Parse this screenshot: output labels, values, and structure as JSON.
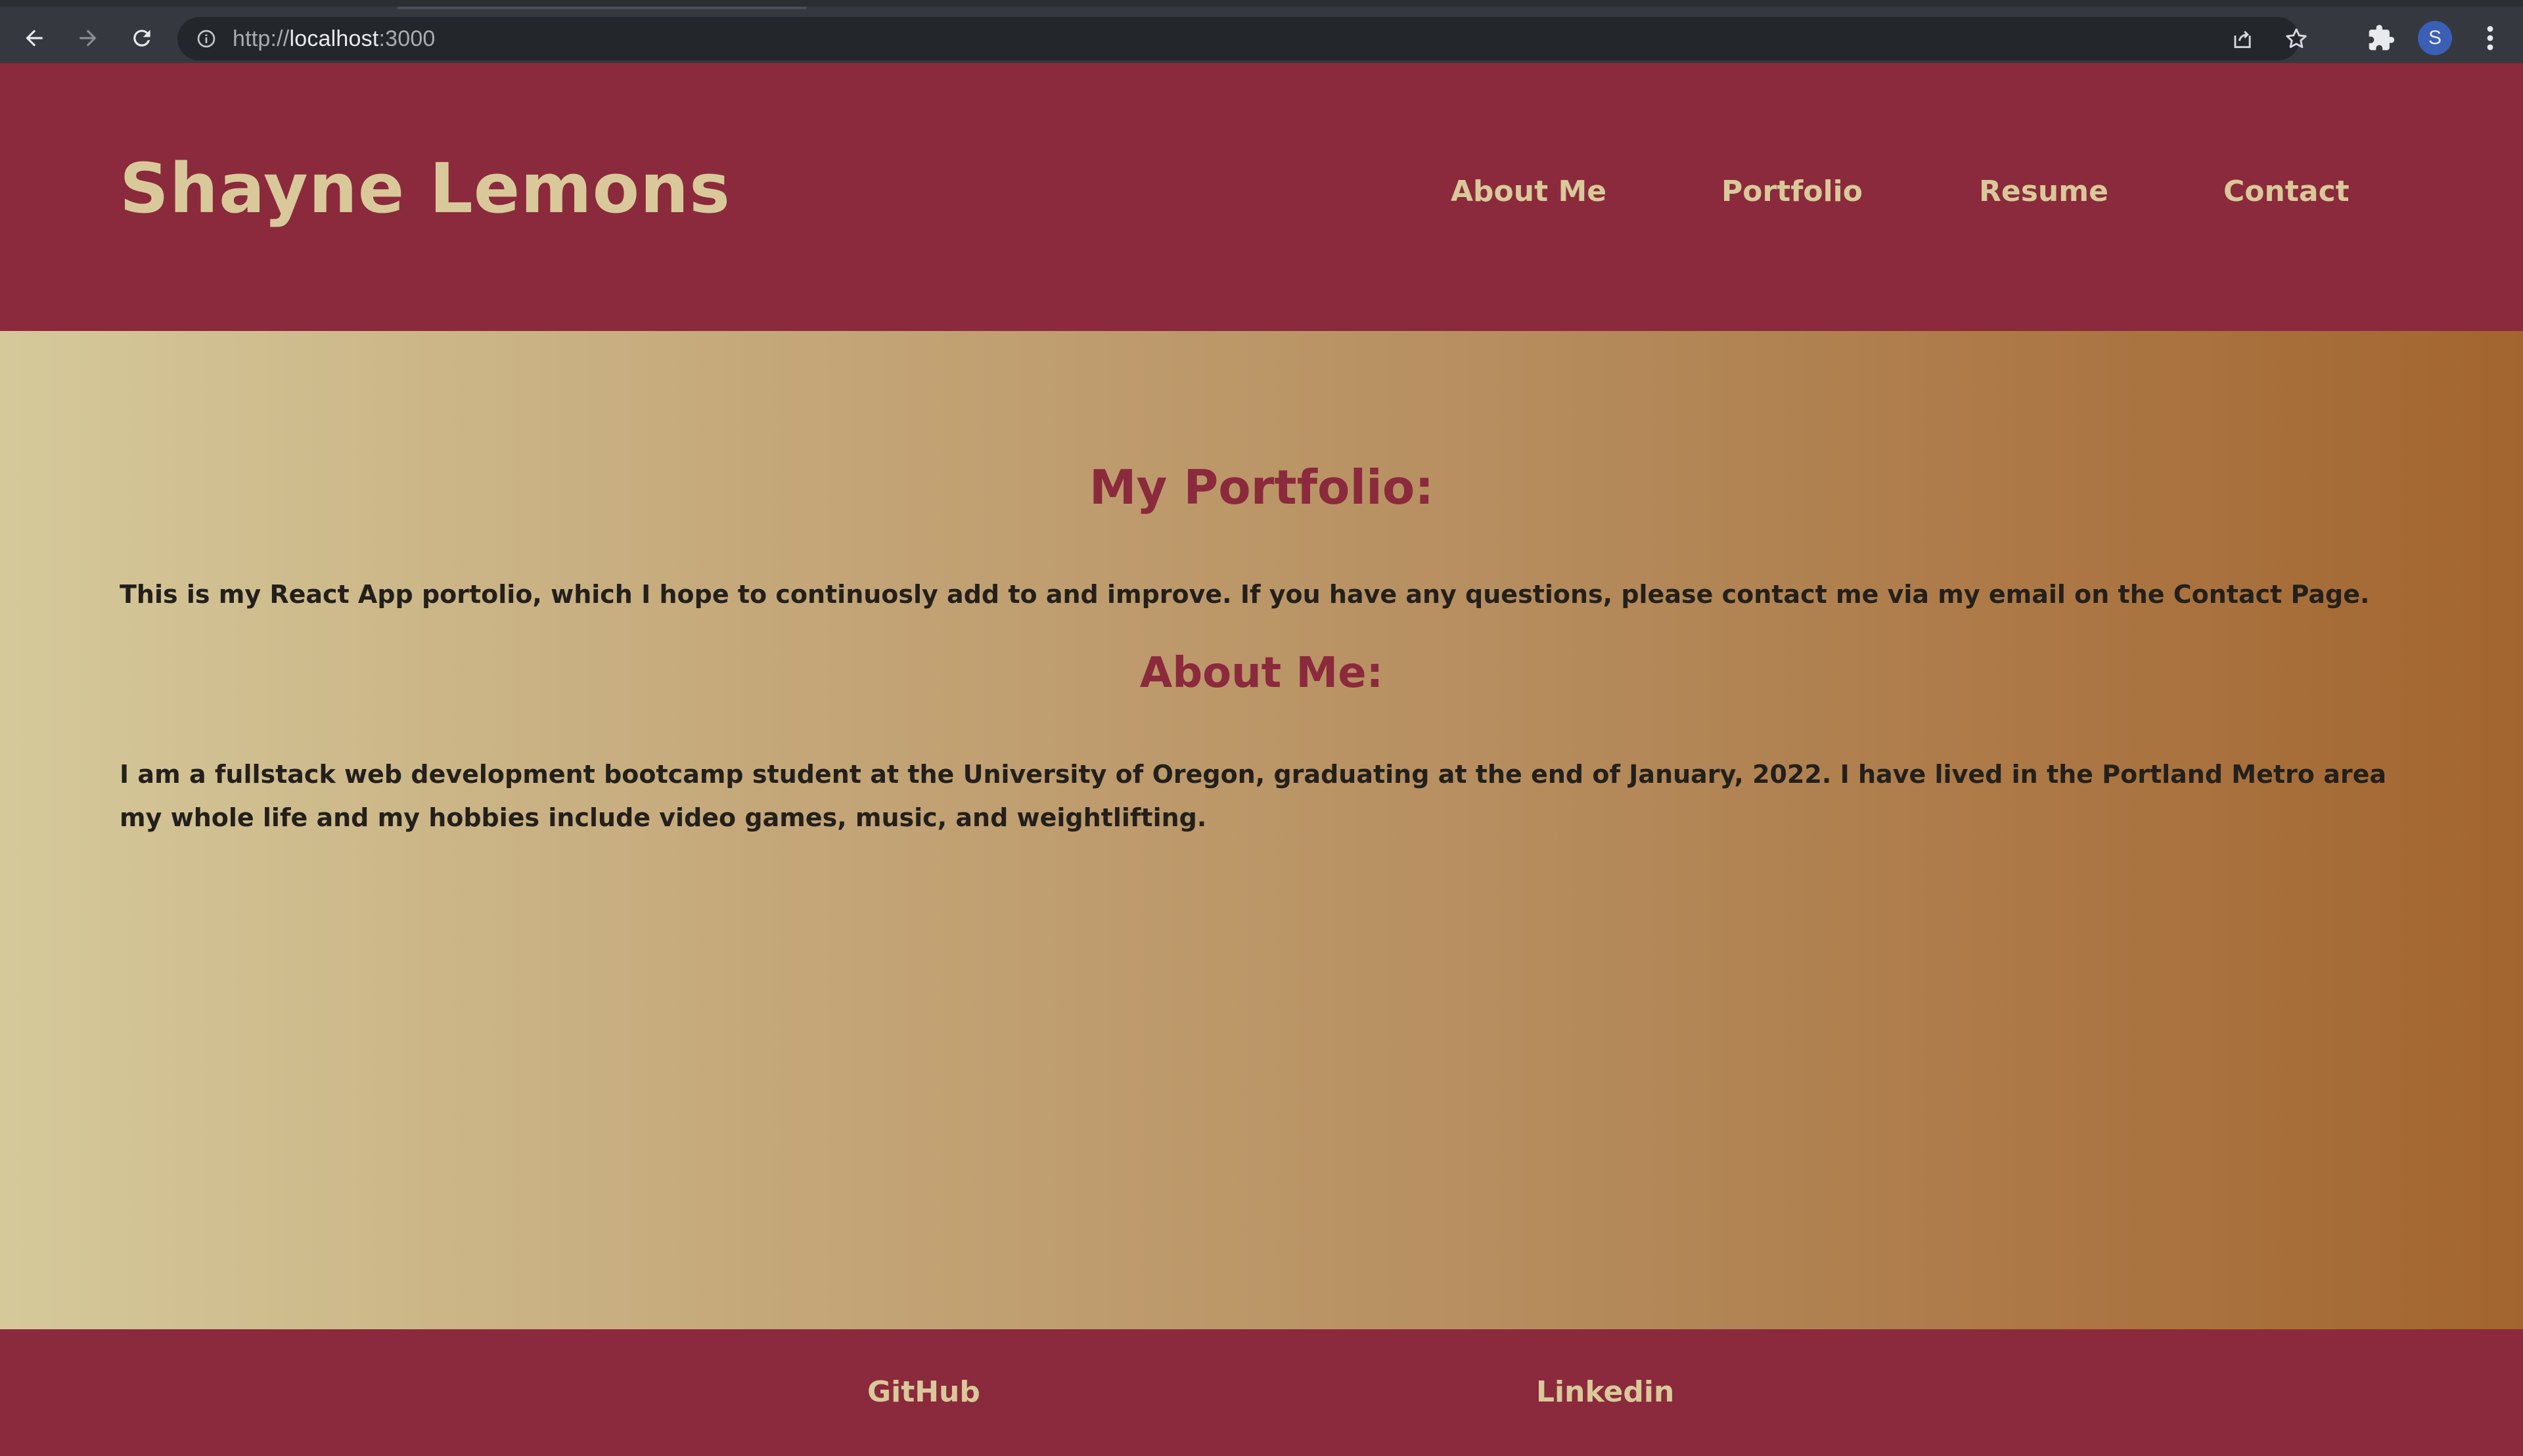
{
  "browser": {
    "url_scheme": "http://",
    "url_host": "localhost",
    "url_port": ":3000",
    "avatar_letter": "S"
  },
  "icons": {
    "back": "arrow-left-icon",
    "forward": "arrow-right-icon",
    "reload": "reload-icon",
    "site_info": "info-icon",
    "share": "share-icon",
    "bookmark": "star-icon",
    "extensions": "puzzle-icon",
    "menu": "kebab-menu-icon"
  },
  "header": {
    "title": "Shayne Lemons",
    "nav": [
      {
        "label": "About Me"
      },
      {
        "label": "Portfolio"
      },
      {
        "label": "Resume"
      },
      {
        "label": "Contact"
      }
    ]
  },
  "main": {
    "portfolio_heading": "My Portfolio:",
    "portfolio_text": "This is my React App portolio, which I hope to continuosly add to and improve. If you have any questions, please contact me via my email on the Contact Page.",
    "about_heading": "About Me:",
    "about_text": "I am a fullstack web development bootcamp student at the University of Oregon, graduating at the end of January, 2022. I have lived in the Portland Metro area my whole life and my hobbies include video games, music, and weightlifting."
  },
  "footer": {
    "links": [
      {
        "label": "GitHub"
      },
      {
        "label": "Linkedin"
      }
    ]
  },
  "colors": {
    "header_bg": "#8b2a3c",
    "accent_text": "#d9c99a",
    "body_text": "#23201c",
    "chrome_bg": "#35393f"
  }
}
